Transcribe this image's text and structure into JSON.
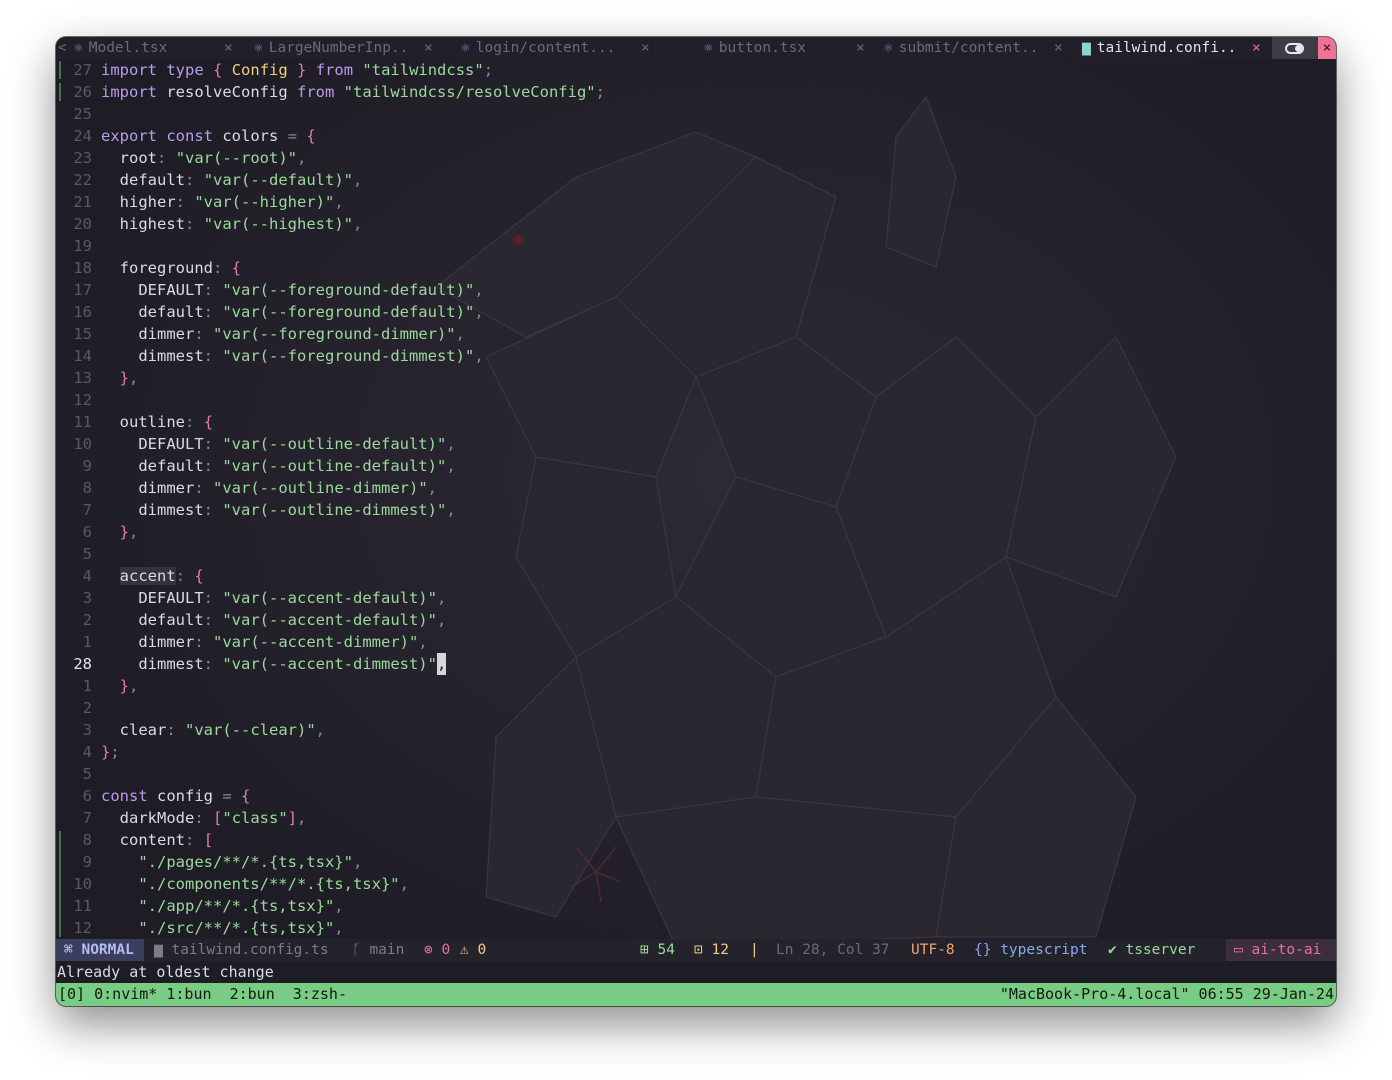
{
  "colors": {
    "background": "#1e1c25",
    "tmux_bar": "#78cc84",
    "close_button": "#f07294",
    "mode_badge": "#3a3d5c"
  },
  "tabs": [
    {
      "label": "Model.tsx",
      "icon": "react-icon",
      "close": "×",
      "active": false
    },
    {
      "label": "LargeNumberInp..",
      "icon": "react-icon",
      "close": "×",
      "active": false
    },
    {
      "label": "login/content...",
      "icon": "react-icon",
      "close": "×",
      "active": false
    },
    {
      "label": "button.tsx",
      "icon": "react-icon",
      "close": "×",
      "active": false
    },
    {
      "label": "submit/content..",
      "icon": "react-icon",
      "close": "×",
      "active": false
    },
    {
      "label": "tailwind.confi..",
      "icon": "typescript-icon",
      "close": "×",
      "active": true
    }
  ],
  "tab_scroll_left": "<",
  "window_close": "×",
  "editor": {
    "current_line": 28,
    "lines": [
      {
        "n": "27",
        "t": "import type { Config } from \"tailwindcss\";"
      },
      {
        "n": "26",
        "t": "import resolveConfig from \"tailwindcss/resolveConfig\";"
      },
      {
        "n": "25",
        "t": ""
      },
      {
        "n": "24",
        "t": "export const colors = {"
      },
      {
        "n": "23",
        "t": "  root: \"var(--root)\","
      },
      {
        "n": "22",
        "t": "  default: \"var(--default)\","
      },
      {
        "n": "21",
        "t": "  higher: \"var(--higher)\","
      },
      {
        "n": "20",
        "t": "  highest: \"var(--highest)\","
      },
      {
        "n": "19",
        "t": ""
      },
      {
        "n": "18",
        "t": "  foreground: {"
      },
      {
        "n": "17",
        "t": "    DEFAULT: \"var(--foreground-default)\","
      },
      {
        "n": "16",
        "t": "    default: \"var(--foreground-default)\","
      },
      {
        "n": "15",
        "t": "    dimmer: \"var(--foreground-dimmer)\","
      },
      {
        "n": "14",
        "t": "    dimmest: \"var(--foreground-dimmest)\","
      },
      {
        "n": "13",
        "t": "  },"
      },
      {
        "n": "12",
        "t": ""
      },
      {
        "n": "11",
        "t": "  outline: {"
      },
      {
        "n": "10",
        "t": "    DEFAULT: \"var(--outline-default)\","
      },
      {
        "n": "9",
        "t": "    default: \"var(--outline-default)\","
      },
      {
        "n": "8",
        "t": "    dimmer: \"var(--outline-dimmer)\","
      },
      {
        "n": "7",
        "t": "    dimmest: \"var(--outline-dimmest)\","
      },
      {
        "n": "6",
        "t": "  },"
      },
      {
        "n": "5",
        "t": ""
      },
      {
        "n": "4",
        "t": "  accent: {"
      },
      {
        "n": "3",
        "t": "    DEFAULT: \"var(--accent-default)\","
      },
      {
        "n": "2",
        "t": "    default: \"var(--accent-default)\","
      },
      {
        "n": "1",
        "t": "    dimmer: \"var(--accent-dimmer)\","
      },
      {
        "n": "28",
        "t": "    dimmest: \"var(--accent-dimmest)\","
      },
      {
        "n": "1",
        "t": "  },"
      },
      {
        "n": "2",
        "t": ""
      },
      {
        "n": "3",
        "t": "  clear: \"var(--clear)\","
      },
      {
        "n": "4",
        "t": "};"
      },
      {
        "n": "5",
        "t": ""
      },
      {
        "n": "6",
        "t": "const config = {"
      },
      {
        "n": "7",
        "t": "  darkMode: [\"class\"],"
      },
      {
        "n": "8",
        "t": "  content: ["
      },
      {
        "n": "9",
        "t": "    \"./pages/**/*.{ts,tsx}\","
      },
      {
        "n": "10",
        "t": "    \"./components/**/*.{ts,tsx}\","
      },
      {
        "n": "11",
        "t": "    \"./app/**/*.{ts,tsx}\","
      },
      {
        "n": "12",
        "t": "    \"./src/**/*.{ts,tsx}\","
      }
    ]
  },
  "statusline": {
    "mode": "NORMAL",
    "file": "tailwind.config.ts",
    "branch": "main",
    "errors": "0",
    "warnings": "0",
    "added": "54",
    "modified": "12",
    "separator": "|",
    "position": "Ln 28, Col 37",
    "encoding": "UTF-8",
    "filetype": "typescript",
    "lsp": "tsserver",
    "project": "ai-to-ai"
  },
  "message": "Already at oldest change",
  "tmux": {
    "windows": "[0] 0:nvim* 1:bun  2:bun  3:zsh-",
    "right": "\"MacBook-Pro-4.local\" 06:55 29-Jan-24"
  }
}
